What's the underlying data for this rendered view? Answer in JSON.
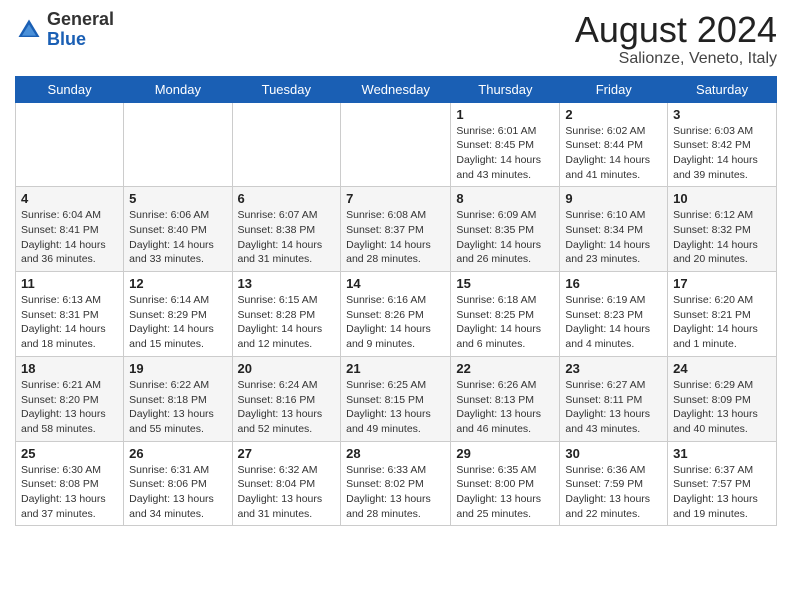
{
  "header": {
    "logo": {
      "general": "General",
      "blue": "Blue"
    },
    "title": "August 2024",
    "location": "Salionze, Veneto, Italy"
  },
  "days_of_week": [
    "Sunday",
    "Monday",
    "Tuesday",
    "Wednesday",
    "Thursday",
    "Friday",
    "Saturday"
  ],
  "weeks": [
    [
      null,
      null,
      null,
      null,
      {
        "day": 1,
        "sunrise": "6:01 AM",
        "sunset": "8:45 PM",
        "daylight": "14 hours and 43 minutes."
      },
      {
        "day": 2,
        "sunrise": "6:02 AM",
        "sunset": "8:44 PM",
        "daylight": "14 hours and 41 minutes."
      },
      {
        "day": 3,
        "sunrise": "6:03 AM",
        "sunset": "8:42 PM",
        "daylight": "14 hours and 39 minutes."
      }
    ],
    [
      {
        "day": 4,
        "sunrise": "6:04 AM",
        "sunset": "8:41 PM",
        "daylight": "14 hours and 36 minutes."
      },
      {
        "day": 5,
        "sunrise": "6:06 AM",
        "sunset": "8:40 PM",
        "daylight": "14 hours and 33 minutes."
      },
      {
        "day": 6,
        "sunrise": "6:07 AM",
        "sunset": "8:38 PM",
        "daylight": "14 hours and 31 minutes."
      },
      {
        "day": 7,
        "sunrise": "6:08 AM",
        "sunset": "8:37 PM",
        "daylight": "14 hours and 28 minutes."
      },
      {
        "day": 8,
        "sunrise": "6:09 AM",
        "sunset": "8:35 PM",
        "daylight": "14 hours and 26 minutes."
      },
      {
        "day": 9,
        "sunrise": "6:10 AM",
        "sunset": "8:34 PM",
        "daylight": "14 hours and 23 minutes."
      },
      {
        "day": 10,
        "sunrise": "6:12 AM",
        "sunset": "8:32 PM",
        "daylight": "14 hours and 20 minutes."
      }
    ],
    [
      {
        "day": 11,
        "sunrise": "6:13 AM",
        "sunset": "8:31 PM",
        "daylight": "14 hours and 18 minutes."
      },
      {
        "day": 12,
        "sunrise": "6:14 AM",
        "sunset": "8:29 PM",
        "daylight": "14 hours and 15 minutes."
      },
      {
        "day": 13,
        "sunrise": "6:15 AM",
        "sunset": "8:28 PM",
        "daylight": "14 hours and 12 minutes."
      },
      {
        "day": 14,
        "sunrise": "6:16 AM",
        "sunset": "8:26 PM",
        "daylight": "14 hours and 9 minutes."
      },
      {
        "day": 15,
        "sunrise": "6:18 AM",
        "sunset": "8:25 PM",
        "daylight": "14 hours and 6 minutes."
      },
      {
        "day": 16,
        "sunrise": "6:19 AM",
        "sunset": "8:23 PM",
        "daylight": "14 hours and 4 minutes."
      },
      {
        "day": 17,
        "sunrise": "6:20 AM",
        "sunset": "8:21 PM",
        "daylight": "14 hours and 1 minute."
      }
    ],
    [
      {
        "day": 18,
        "sunrise": "6:21 AM",
        "sunset": "8:20 PM",
        "daylight": "13 hours and 58 minutes."
      },
      {
        "day": 19,
        "sunrise": "6:22 AM",
        "sunset": "8:18 PM",
        "daylight": "13 hours and 55 minutes."
      },
      {
        "day": 20,
        "sunrise": "6:24 AM",
        "sunset": "8:16 PM",
        "daylight": "13 hours and 52 minutes."
      },
      {
        "day": 21,
        "sunrise": "6:25 AM",
        "sunset": "8:15 PM",
        "daylight": "13 hours and 49 minutes."
      },
      {
        "day": 22,
        "sunrise": "6:26 AM",
        "sunset": "8:13 PM",
        "daylight": "13 hours and 46 minutes."
      },
      {
        "day": 23,
        "sunrise": "6:27 AM",
        "sunset": "8:11 PM",
        "daylight": "13 hours and 43 minutes."
      },
      {
        "day": 24,
        "sunrise": "6:29 AM",
        "sunset": "8:09 PM",
        "daylight": "13 hours and 40 minutes."
      }
    ],
    [
      {
        "day": 25,
        "sunrise": "6:30 AM",
        "sunset": "8:08 PM",
        "daylight": "13 hours and 37 minutes."
      },
      {
        "day": 26,
        "sunrise": "6:31 AM",
        "sunset": "8:06 PM",
        "daylight": "13 hours and 34 minutes."
      },
      {
        "day": 27,
        "sunrise": "6:32 AM",
        "sunset": "8:04 PM",
        "daylight": "13 hours and 31 minutes."
      },
      {
        "day": 28,
        "sunrise": "6:33 AM",
        "sunset": "8:02 PM",
        "daylight": "13 hours and 28 minutes."
      },
      {
        "day": 29,
        "sunrise": "6:35 AM",
        "sunset": "8:00 PM",
        "daylight": "13 hours and 25 minutes."
      },
      {
        "day": 30,
        "sunrise": "6:36 AM",
        "sunset": "7:59 PM",
        "daylight": "13 hours and 22 minutes."
      },
      {
        "day": 31,
        "sunrise": "6:37 AM",
        "sunset": "7:57 PM",
        "daylight": "13 hours and 19 minutes."
      }
    ]
  ]
}
